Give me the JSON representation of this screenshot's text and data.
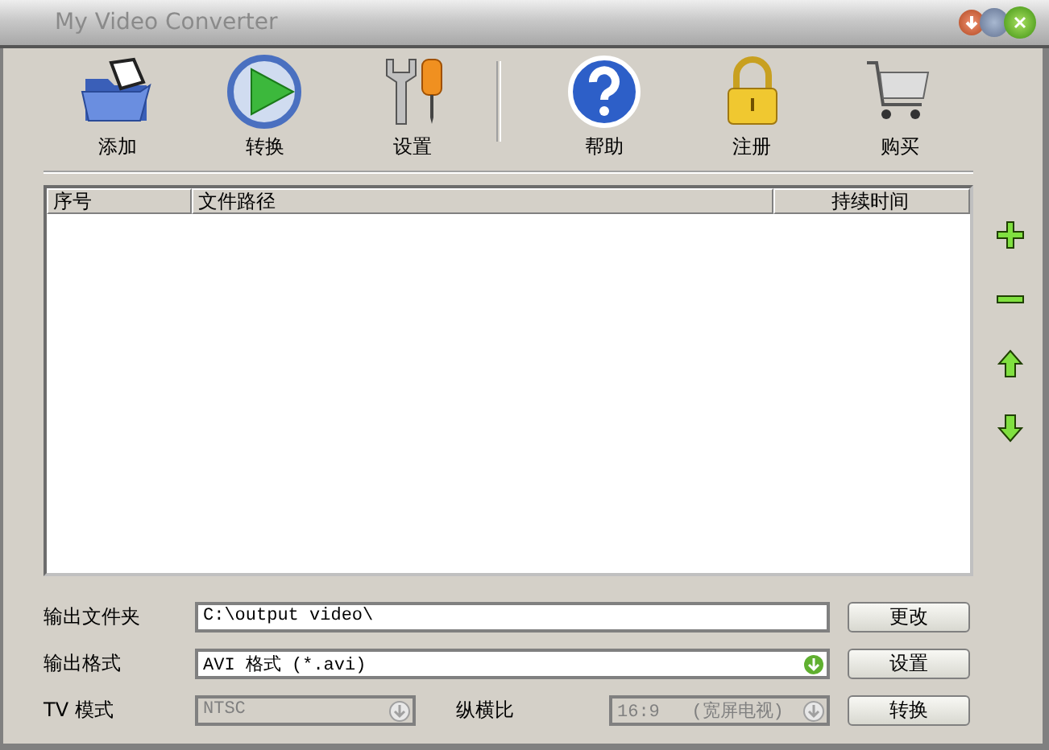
{
  "window": {
    "title": "My Video Converter"
  },
  "toolbar": [
    {
      "kind": "add",
      "label": "添加"
    },
    {
      "kind": "convert",
      "label": "转换"
    },
    {
      "kind": "settings",
      "label": "设置"
    },
    {
      "kind": "separator"
    },
    {
      "kind": "help",
      "label": "帮助"
    },
    {
      "kind": "register",
      "label": "注册"
    },
    {
      "kind": "buy",
      "label": "购买"
    }
  ],
  "table": {
    "columns": [
      "序号",
      "文件路径",
      "持续时间"
    ]
  },
  "side_buttons": [
    {
      "kind": "add"
    },
    {
      "kind": "remove"
    },
    {
      "kind": "up"
    },
    {
      "kind": "down"
    }
  ],
  "output_folder": {
    "label": "输出文件夹",
    "value": "C:\\output video\\",
    "button": "更改"
  },
  "output_format": {
    "label": "输出格式",
    "value": "AVI 格式 (*.avi)",
    "button": "设置"
  },
  "tv_mode": {
    "label": "TV 模式",
    "value": "NTSC",
    "disabled": true
  },
  "aspect": {
    "label": "纵横比",
    "value": "16:9   (宽屏电视)",
    "disabled": true
  },
  "convert_button": "转换"
}
